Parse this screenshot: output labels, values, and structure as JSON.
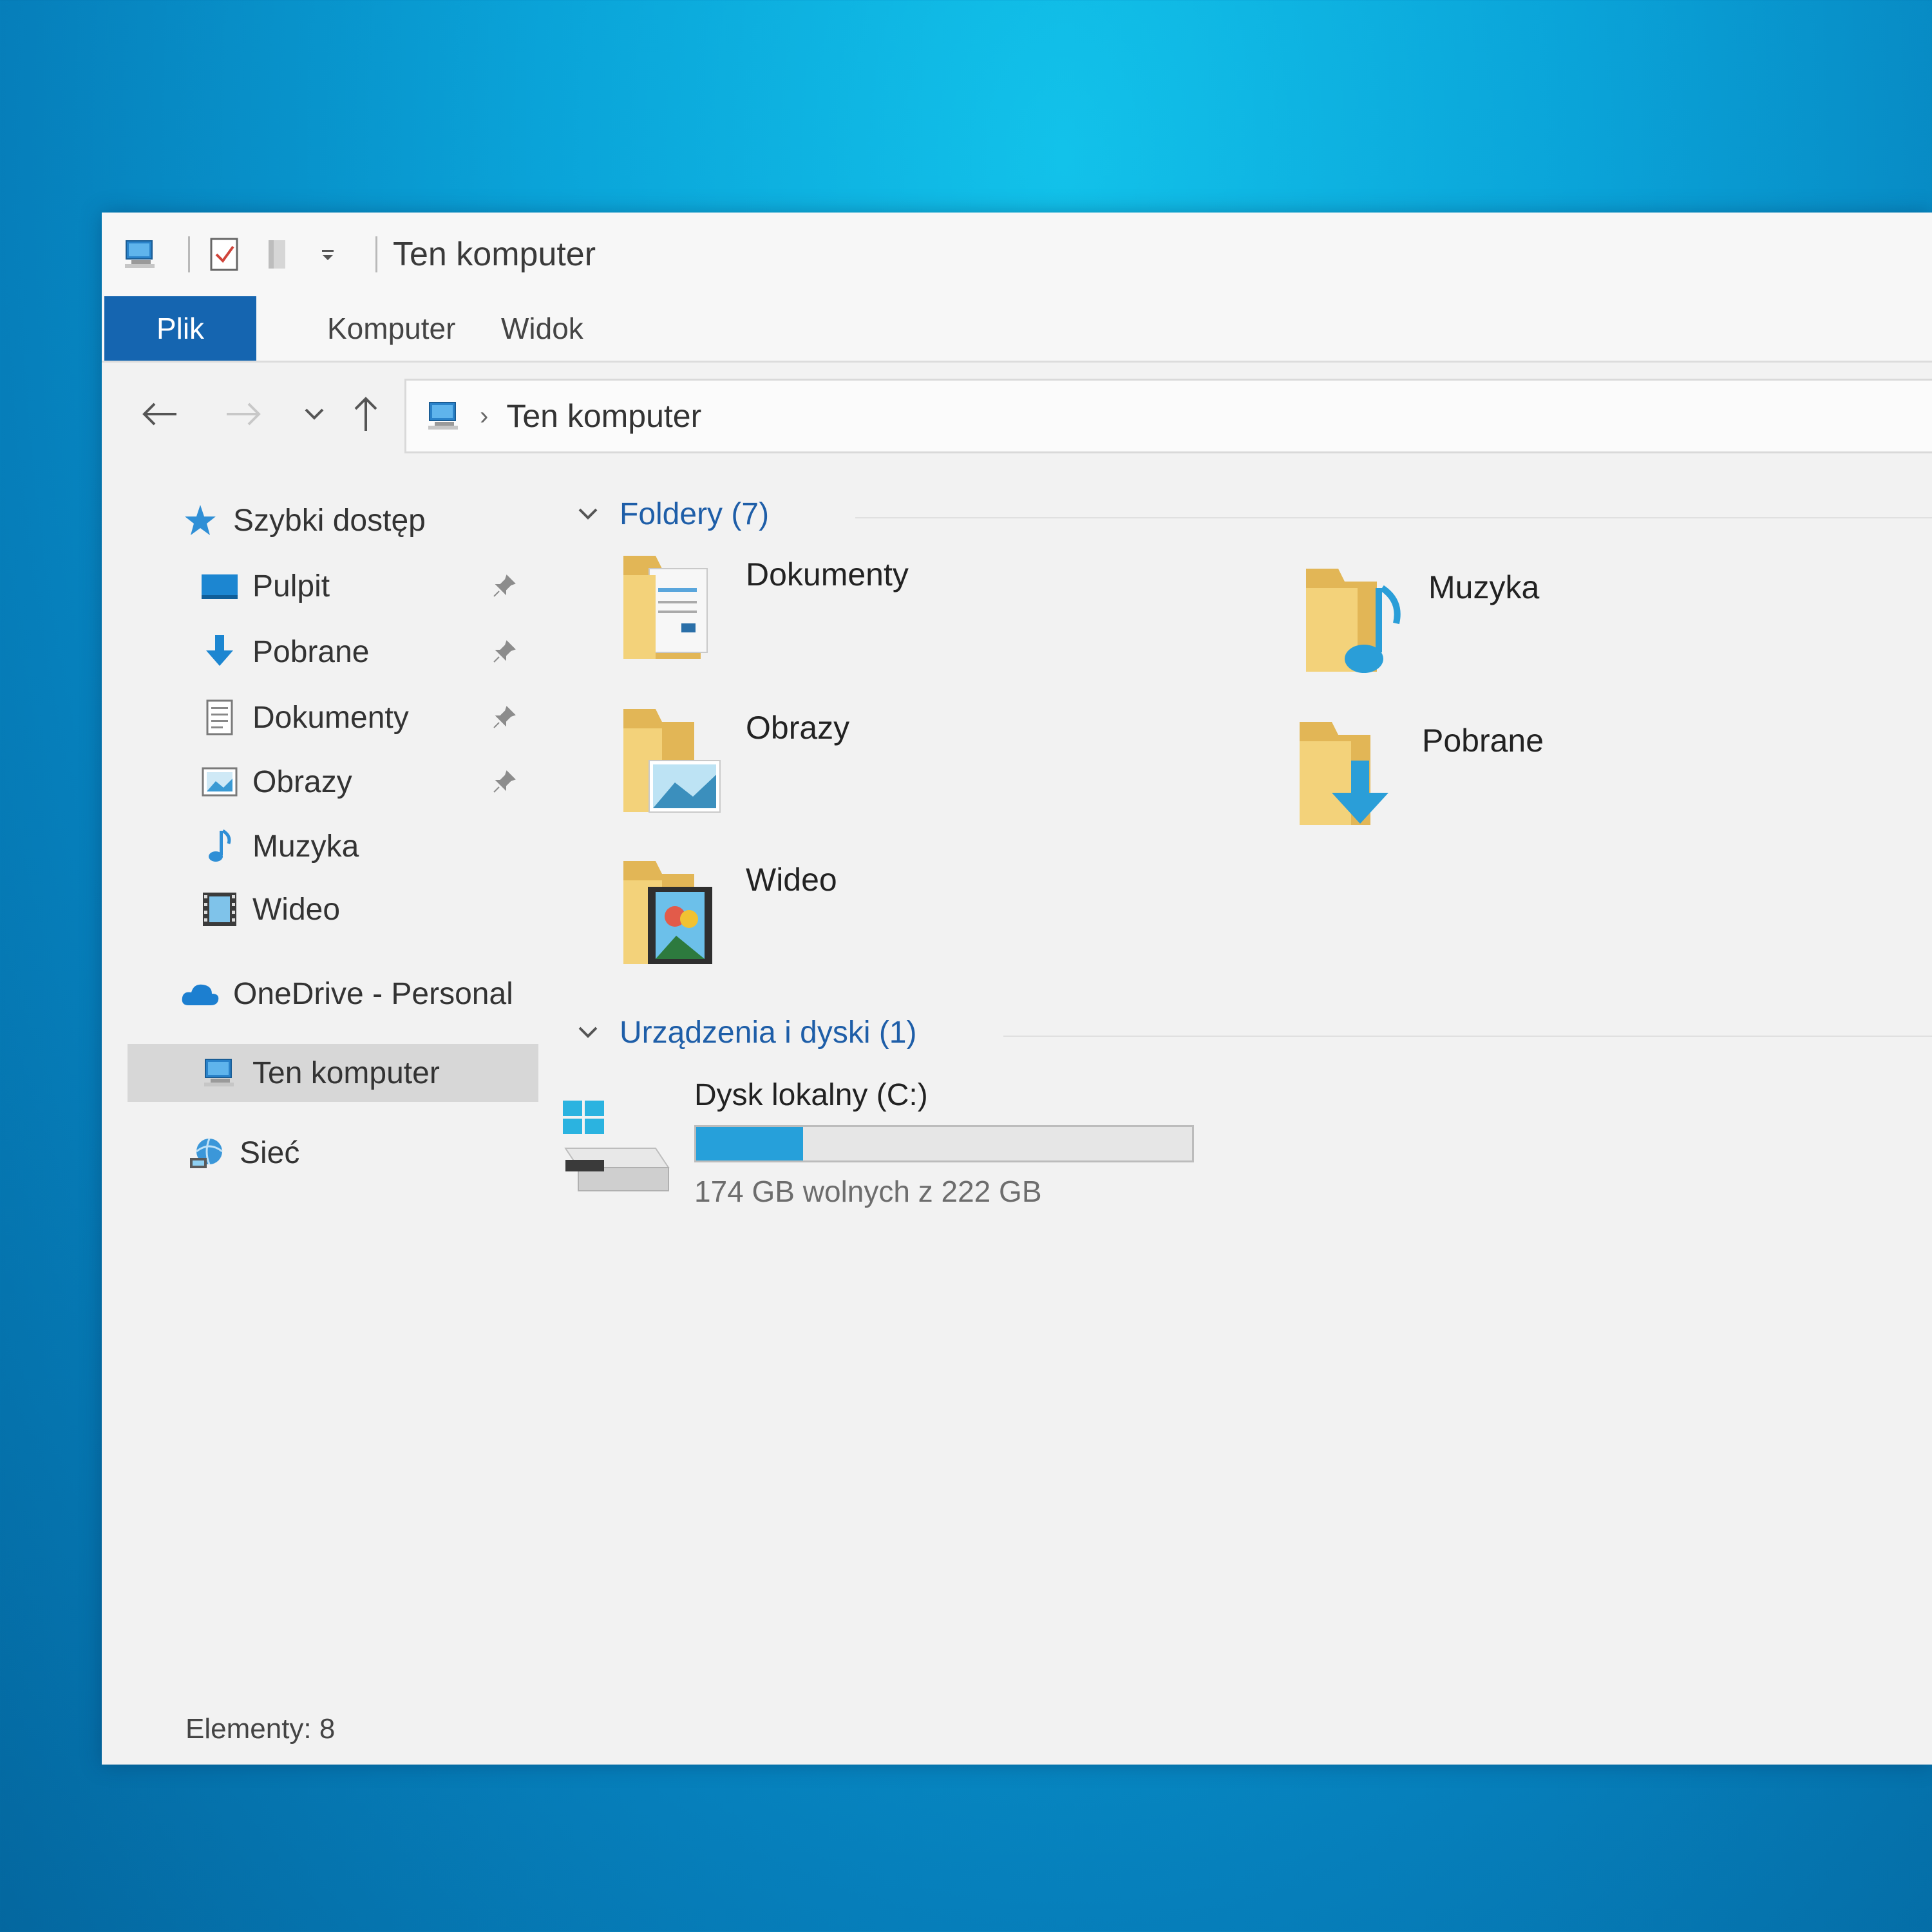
{
  "window": {
    "title": "Ten komputer",
    "quick_access_toolbar": [
      "computer-icon",
      "properties-check-icon",
      "new-folder-icon",
      "customize-dropdown-icon"
    ]
  },
  "ribbon": {
    "tabs": [
      {
        "label": "Plik",
        "active": true
      },
      {
        "label": "Komputer",
        "active": false
      },
      {
        "label": "Widok",
        "active": false
      }
    ]
  },
  "nav": {
    "back_enabled": true,
    "forward_enabled": false,
    "breadcrumb": [
      "Ten komputer"
    ]
  },
  "sidebar": {
    "quick_access": {
      "label": "Szybki dostęp",
      "icon": "star-icon"
    },
    "pinned": [
      {
        "label": "Pulpit",
        "icon": "desktop-icon",
        "pinned": true
      },
      {
        "label": "Pobrane",
        "icon": "download-icon",
        "pinned": true
      },
      {
        "label": "Dokumenty",
        "icon": "document-icon",
        "pinned": true
      },
      {
        "label": "Obrazy",
        "icon": "picture-icon",
        "pinned": true
      },
      {
        "label": "Muzyka",
        "icon": "music-icon",
        "pinned": false
      },
      {
        "label": "Wideo",
        "icon": "video-icon",
        "pinned": false
      }
    ],
    "onedrive": {
      "label": "OneDrive - Personal",
      "icon": "cloud-icon"
    },
    "this_pc": {
      "label": "Ten komputer",
      "icon": "computer-icon",
      "selected": true
    },
    "network": {
      "label": "Sieć",
      "icon": "network-icon"
    }
  },
  "content": {
    "folders_header": "Foldery (7)",
    "folders": [
      {
        "label": "Dokumenty",
        "icon": "documents-folder-icon"
      },
      {
        "label": "Muzyka",
        "icon": "music-folder-icon"
      },
      {
        "label": "Obrazy",
        "icon": "pictures-folder-icon"
      },
      {
        "label": "Pobrane",
        "icon": "downloads-folder-icon"
      },
      {
        "label": "Wideo",
        "icon": "videos-folder-icon"
      }
    ],
    "devices_header": "Urządzenia i dyski (1)",
    "drives": [
      {
        "label": "Dysk lokalny (C:)",
        "free_text": "174 GB wolnych z 222 GB",
        "used_fraction": 0.216,
        "bar_color": "#26a0da"
      }
    ]
  },
  "status": {
    "items_text": "Elementy: 8"
  },
  "colors": {
    "accent": "#1565b0",
    "header_blue": "#1e5ea8",
    "drive_bar": "#26a0da",
    "folder_yellow": "#f3d27a"
  }
}
